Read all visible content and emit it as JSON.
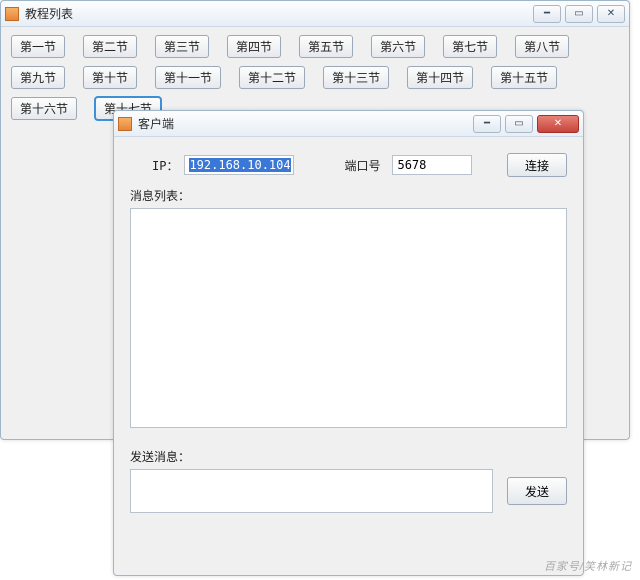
{
  "main_window": {
    "title": "教程列表",
    "lessons": [
      "第一节",
      "第二节",
      "第三节",
      "第四节",
      "第五节",
      "第六节",
      "第七节",
      "第八节",
      "第九节",
      "第十节",
      "第十一节",
      "第十二节",
      "第十三节",
      "第十四节",
      "第十五节",
      "第十六节",
      "第十七节"
    ],
    "selected_index": 16
  },
  "client_window": {
    "title": "客户端",
    "ip_label": "IP：",
    "ip_value": "192.168.10.104",
    "port_label": "端口号",
    "port_value": "5678",
    "connect_label": "连接",
    "msglist_label": "消息列表：",
    "msglist_value": "",
    "sendmsg_label": "发送消息：",
    "sendmsg_value": "",
    "send_label": "发送"
  },
  "watermark": "百家号/笑林新记"
}
